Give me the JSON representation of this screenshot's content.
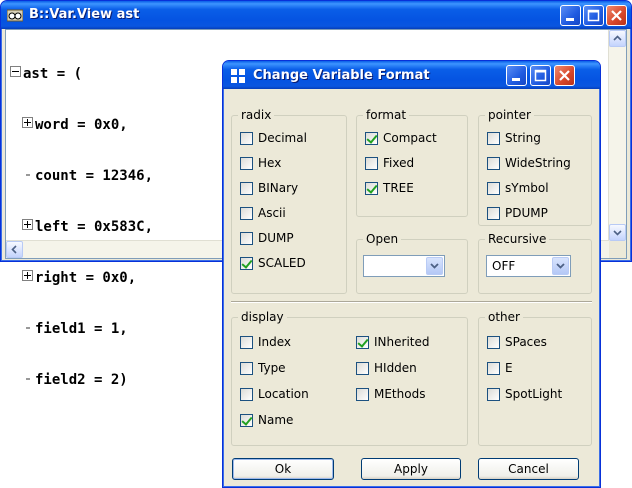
{
  "var_view": {
    "title": "B::Var.View ast",
    "lines": [
      {
        "expander": "minus",
        "text": "ast = ("
      },
      {
        "expander": "plus",
        "text": "word = 0x0,"
      },
      {
        "expander": "leaf",
        "text": "count = 12346,"
      },
      {
        "expander": "plus",
        "text": "left = 0x583C,"
      },
      {
        "expander": "plus",
        "text": "right = 0x0,"
      },
      {
        "expander": "leaf",
        "text": "field1 = 1,"
      },
      {
        "expander": "leaf",
        "text": "field2 = 2)"
      }
    ]
  },
  "dialog": {
    "title": "Change Variable Format",
    "radix": {
      "label": "radix",
      "options": [
        {
          "label": "Decimal",
          "checked": false
        },
        {
          "label": "Hex",
          "checked": false
        },
        {
          "label": "BINary",
          "checked": false
        },
        {
          "label": "Ascii",
          "checked": false
        },
        {
          "label": "DUMP",
          "checked": false
        },
        {
          "label": "SCALED",
          "checked": true
        }
      ]
    },
    "format": {
      "label": "format",
      "options": [
        {
          "label": "Compact",
          "checked": true
        },
        {
          "label": "Fixed",
          "checked": false
        },
        {
          "label": "TREE",
          "checked": true
        }
      ]
    },
    "open": {
      "label": "Open",
      "value": ""
    },
    "pointer": {
      "label": "pointer",
      "options": [
        {
          "label": "String",
          "checked": false
        },
        {
          "label": "WideString",
          "checked": false
        },
        {
          "label": "sYmbol",
          "checked": false
        },
        {
          "label": "PDUMP",
          "checked": false
        }
      ]
    },
    "recursive": {
      "label": "Recursive",
      "value": "OFF"
    },
    "display": {
      "label": "display",
      "col1": [
        {
          "label": "Index",
          "checked": false
        },
        {
          "label": "Type",
          "checked": false
        },
        {
          "label": "Location",
          "checked": false
        },
        {
          "label": "Name",
          "checked": true
        }
      ],
      "col2": [
        {
          "label": "INherited",
          "checked": true
        },
        {
          "label": "HIdden",
          "checked": false
        },
        {
          "label": "MEthods",
          "checked": false
        }
      ]
    },
    "other": {
      "label": "other",
      "options": [
        {
          "label": "SPaces",
          "checked": false
        },
        {
          "label": "E",
          "checked": false
        },
        {
          "label": "SpotLight",
          "checked": false
        }
      ]
    },
    "buttons": {
      "ok": "Ok",
      "apply": "Apply",
      "cancel": "Cancel"
    }
  }
}
